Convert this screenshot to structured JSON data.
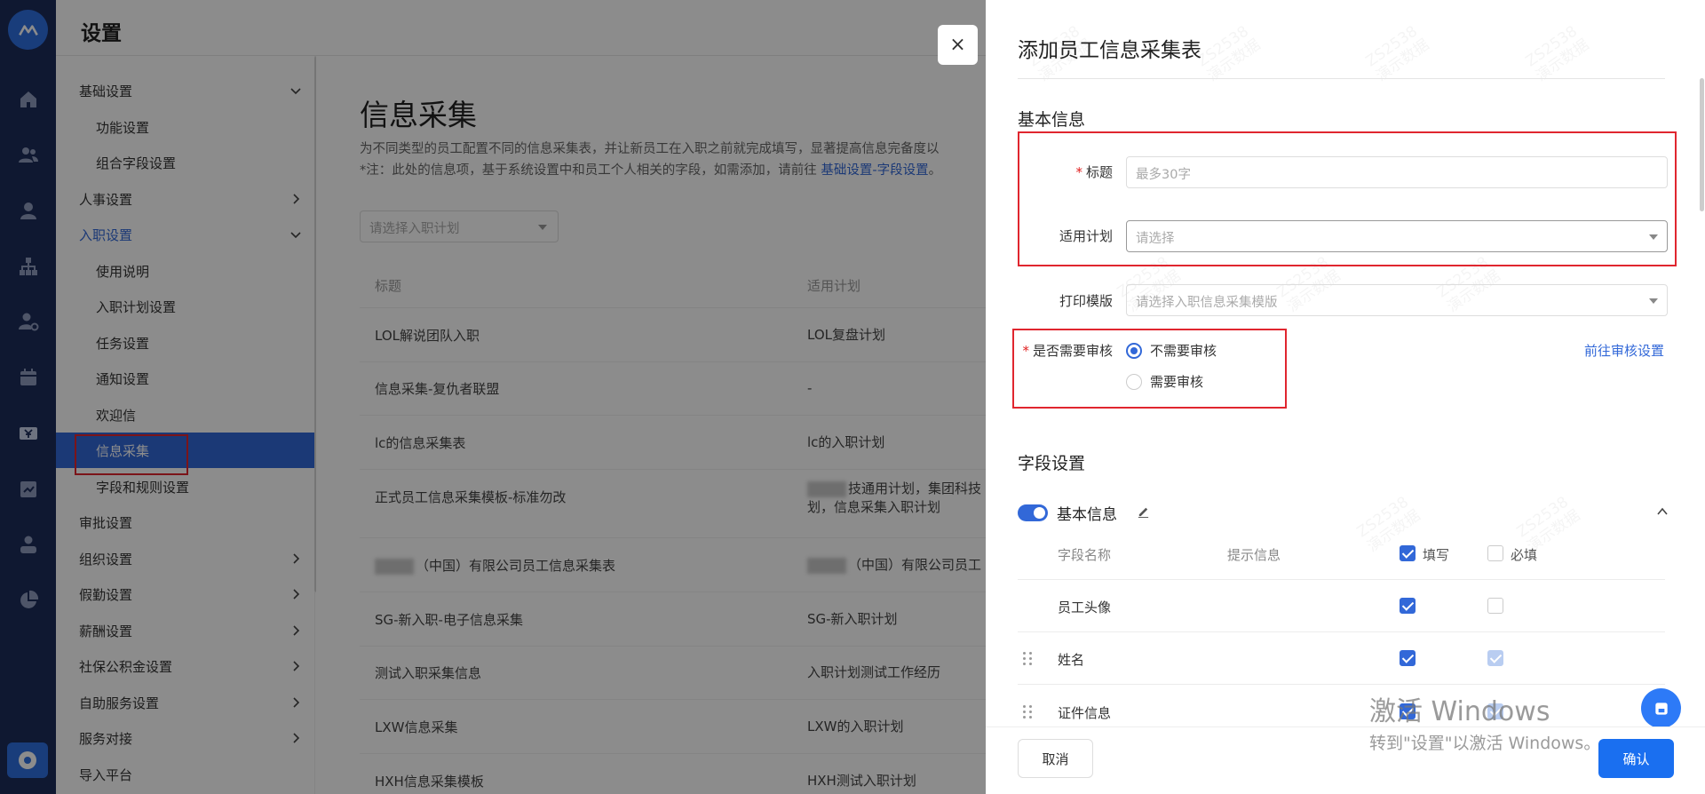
{
  "app": {
    "settings_title": "设置"
  },
  "rail": {
    "icons": [
      "logo-icon",
      "home-icon",
      "people-icon",
      "person-icon",
      "org-chart-icon",
      "person-gear-icon",
      "calendar-icon",
      "money-icon",
      "approval-icon",
      "user-icon",
      "pie-chart-icon",
      "settings-disc-icon"
    ]
  },
  "sidebar": {
    "items": [
      {
        "label": "基础设置",
        "chevron": "down"
      },
      {
        "label": "功能设置",
        "sub": true
      },
      {
        "label": "组合字段设置",
        "sub": true
      },
      {
        "label": "人事设置",
        "chevron": "right"
      },
      {
        "label": "入职设置",
        "chevron": "down",
        "state": "expanded"
      },
      {
        "label": "使用说明",
        "sub": true
      },
      {
        "label": "入职计划设置",
        "sub": true
      },
      {
        "label": "任务设置",
        "sub": true
      },
      {
        "label": "通知设置",
        "sub": true
      },
      {
        "label": "欢迎信",
        "sub": true
      },
      {
        "label": "信息采集",
        "sub": true,
        "state": "active"
      },
      {
        "label": "字段和规则设置",
        "sub": true
      },
      {
        "label": "审批设置"
      },
      {
        "label": "组织设置",
        "chevron": "right"
      },
      {
        "label": "假勤设置",
        "chevron": "right"
      },
      {
        "label": "薪酬设置",
        "chevron": "right"
      },
      {
        "label": "社保公积金设置",
        "chevron": "right"
      },
      {
        "label": "自助服务设置",
        "chevron": "right"
      },
      {
        "label": "服务对接",
        "chevron": "right"
      },
      {
        "label": "导入平台"
      }
    ]
  },
  "main": {
    "title": "信息采集",
    "desc1": "为不同类型的员工配置不同的信息采集表，并让新员工在入职之前就完成填写，显著提高信息完备度以",
    "desc2_prefix": "*注：此处的信息项，基于系统设置中和员工个人相关的字段，如需添加，请前往 ",
    "desc2_link": "基础设置-字段设置",
    "desc2_suffix": "。",
    "plan_filter_placeholder": "请选择入职计划",
    "table": {
      "headers": [
        "标题",
        "适用计划"
      ],
      "rows": [
        {
          "title": "LOL解说团队入职",
          "plan": "LOL复盘计划"
        },
        {
          "title": "信息采集-复仇者联盟",
          "plan": "-"
        },
        {
          "title": "lc的信息采集表",
          "plan": "lc的入职计划"
        },
        {
          "title": "正式员工信息采集模板-标准勿改",
          "plan": "技通用计划，集团科技",
          "plan_line2": "划，信息采集入职计划"
        },
        {
          "title": "（中国）有限公司员工信息采集表",
          "plan": "（中国）有限公司员工"
        },
        {
          "title": "SG-新入职-电子信息采集",
          "plan": "SG-新入职计划"
        },
        {
          "title": "测试入职采集信息",
          "plan": "入职计划测试工作经历"
        },
        {
          "title": "LXW信息采集",
          "plan": "LXW的入职计划"
        },
        {
          "title": "HXH信息采集模板",
          "plan": "HXH测试入职计划"
        }
      ]
    }
  },
  "drawer": {
    "close": "×",
    "title": "添加员工信息采集表",
    "basic_section": "基本信息",
    "form": {
      "title_label": "标题",
      "title_placeholder": "最多30字",
      "plan_label": "适用计划",
      "plan_placeholder": "请选择",
      "print_label": "打印模版",
      "print_placeholder": "请选择入职信息采集模版",
      "review_label": "是否需要审核",
      "review_options": [
        "不需要审核",
        "需要审核"
      ],
      "review_selected": "不需要审核",
      "review_link": "前往审核设置"
    },
    "field_section": "字段设置",
    "group": {
      "name": "基本信息",
      "enabled": true,
      "headers": {
        "name": "字段名称",
        "hint": "提示信息",
        "fill": "填写",
        "required": "必填"
      },
      "fields": [
        {
          "name": "员工头像",
          "fill": true,
          "required": false
        },
        {
          "name": "姓名",
          "fill": true,
          "required": true,
          "locked": true
        },
        {
          "name": "证件信息",
          "fill": true,
          "required": true,
          "locked": true
        }
      ]
    },
    "cancel": "取消",
    "confirm": "确认"
  },
  "watermark": {
    "code": "ZS2538",
    "text": "演示数据"
  },
  "windows_activation": {
    "line1": "激活 Windows",
    "line2": "转到\"设置\"以激活 Windows。"
  },
  "colors": {
    "rail": "#1c2c5a",
    "accent": "#3268d8",
    "primary_button": "#1a6ff0",
    "highlight_box": "#e0262f"
  }
}
